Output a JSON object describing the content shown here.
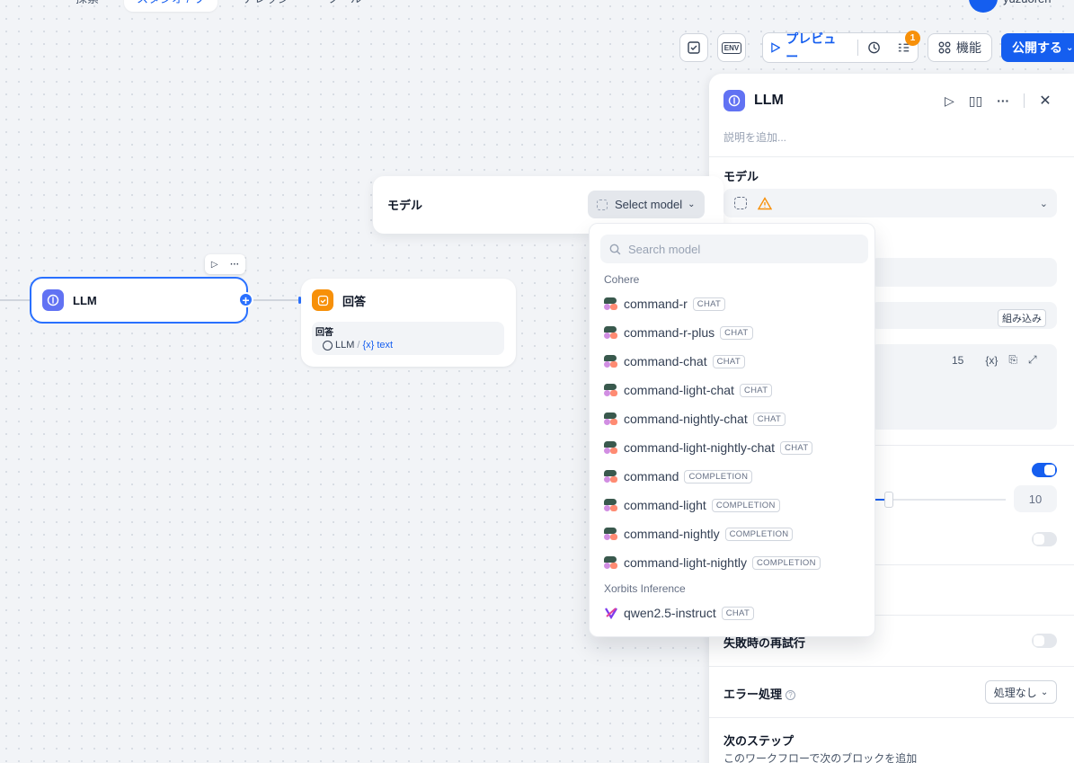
{
  "topbar": {
    "tabs": [
      "探索",
      "スタジオ / ワ",
      "ナレッジ",
      "ツール"
    ],
    "user": "yuzuoren"
  },
  "toolbar": {
    "preview_label": "プレビュー",
    "badge_count": "1",
    "features_label": "機能",
    "publish_label": "公開する",
    "env_label": "ENV"
  },
  "canvas": {
    "llm_node": {
      "title": "LLM"
    },
    "answer_node": {
      "title": "回答",
      "var_label": "回答",
      "var_node": "LLM",
      "var_sep": "/",
      "var_name": "{x} text"
    },
    "model_card": {
      "label": "モデル",
      "select_placeholder": "Select model"
    }
  },
  "dropdown": {
    "search_placeholder": "Search model",
    "providers": [
      {
        "name": "Cohere",
        "models": [
          {
            "name": "command-r",
            "tag": "CHAT"
          },
          {
            "name": "command-r-plus",
            "tag": "CHAT"
          },
          {
            "name": "command-chat",
            "tag": "CHAT"
          },
          {
            "name": "command-light-chat",
            "tag": "CHAT"
          },
          {
            "name": "command-nightly-chat",
            "tag": "CHAT"
          },
          {
            "name": "command-light-nightly-chat",
            "tag": "CHAT"
          },
          {
            "name": "command",
            "tag": "COMPLETION"
          },
          {
            "name": "command-light",
            "tag": "COMPLETION"
          },
          {
            "name": "command-nightly",
            "tag": "COMPLETION"
          },
          {
            "name": "command-light-nightly",
            "tag": "COMPLETION"
          }
        ]
      },
      {
        "name": "Xorbits Inference",
        "models": [
          {
            "name": "qwen2.5-instruct",
            "tag": "CHAT"
          }
        ]
      }
    ]
  },
  "panel": {
    "title": "LLM",
    "description_placeholder": "説明を追加...",
    "model_section": "モデル",
    "builtin_label": "組み込み",
    "prompt_char_count": "15",
    "prompt_var_icon": "{x}",
    "memory_window_value": "10",
    "memory_window_level": 0.1,
    "retry_label": "失敗時の再試行",
    "error_label": "エラー処理",
    "error_value": "処理なし",
    "next_step_title": "次のステップ",
    "next_step_desc": "このワークフローで次のブロックを追加"
  },
  "colors": {
    "accent": "#155eef",
    "llm_icon": "#6172f3",
    "answer_icon": "#f79009",
    "warning": "#f79009"
  }
}
